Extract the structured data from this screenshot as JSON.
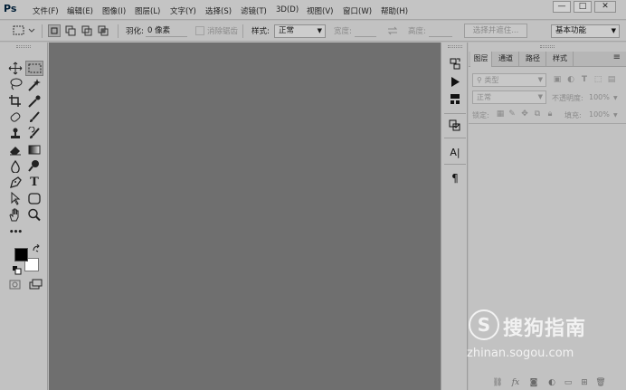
{
  "app": {
    "logo": "Ps"
  },
  "menu": [
    "文件(F)",
    "编辑(E)",
    "图像(I)",
    "图层(L)",
    "文字(Y)",
    "选择(S)",
    "滤镜(T)",
    "3D(D)",
    "视图(V)",
    "窗口(W)",
    "帮助(H)"
  ],
  "window_controls": {
    "minimize": "—",
    "maximize": "□",
    "close": "✕"
  },
  "options": {
    "feather_label": "羽化:",
    "feather_value": "0 像素",
    "antialias_label": "消除锯齿",
    "style_label": "样式:",
    "style_value": "正常",
    "width_label": "宽度:",
    "height_label": "高度:",
    "select_mask_button": "选择并遮住...",
    "workspace_value": "基本功能"
  },
  "toolbar": {
    "tools": [
      "move-tool",
      "marquee-tool",
      "lasso-tool",
      "quick-select-tool",
      "crop-tool",
      "eyedropper-tool",
      "healing-brush-tool",
      "brush-tool",
      "clone-stamp-tool",
      "history-brush-tool",
      "eraser-tool",
      "gradient-tool",
      "blur-tool",
      "dodge-tool",
      "pen-tool",
      "type-tool",
      "path-select-tool",
      "shape-tool",
      "hand-tool",
      "zoom-tool",
      "more-tools"
    ],
    "type_tool_glyph": "T",
    "more_glyph": "•••",
    "foreground_color": "#000000",
    "background_color": "#ffffff"
  },
  "strip": {
    "character_glyph": "A|",
    "paragraph_glyph": "¶"
  },
  "layers_panel": {
    "tabs": [
      "图层",
      "通道",
      "路径",
      "样式"
    ],
    "filter_label": "类型",
    "blend_mode": "正常",
    "opacity_label": "不透明度:",
    "opacity_value": "100%",
    "lock_label": "锁定:",
    "fill_label": "填充:",
    "fill_value": "100%"
  },
  "watermark": {
    "title": "搜狗指南",
    "url": "zhinan.sogou.com"
  }
}
